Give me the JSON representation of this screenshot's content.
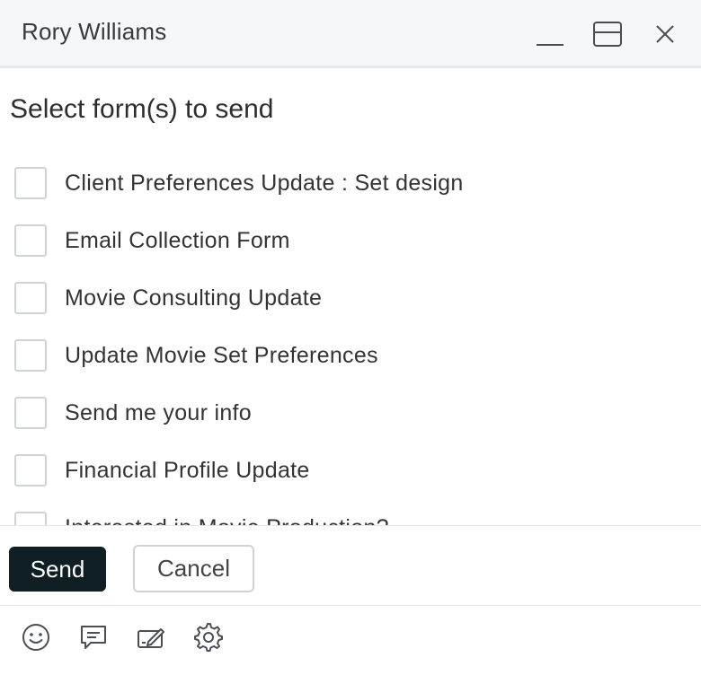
{
  "window": {
    "title": "Rory Williams"
  },
  "content": {
    "section_title": "Select form(s) to send",
    "forms": [
      {
        "label": "Client Preferences Update : Set design",
        "checked": false
      },
      {
        "label": "Email Collection Form",
        "checked": false
      },
      {
        "label": "Movie Consulting Update",
        "checked": false
      },
      {
        "label": "Update Movie Set Preferences",
        "checked": false
      },
      {
        "label": "Send me your info",
        "checked": false
      },
      {
        "label": "Financial Profile Update",
        "checked": false
      },
      {
        "label": "Interested in Movie Production?",
        "checked": false
      }
    ]
  },
  "actions": {
    "send_label": "Send",
    "cancel_label": "Cancel"
  },
  "toolbar": {
    "icons": [
      "emoji-icon",
      "chat-icon",
      "edit-icon",
      "gear-icon"
    ]
  },
  "colors": {
    "header_bg": "#f6f7f9",
    "send_bg": "#0f1f24",
    "checkbox_border": "#cfd2d6",
    "icon_stroke": "#4a4f55"
  }
}
